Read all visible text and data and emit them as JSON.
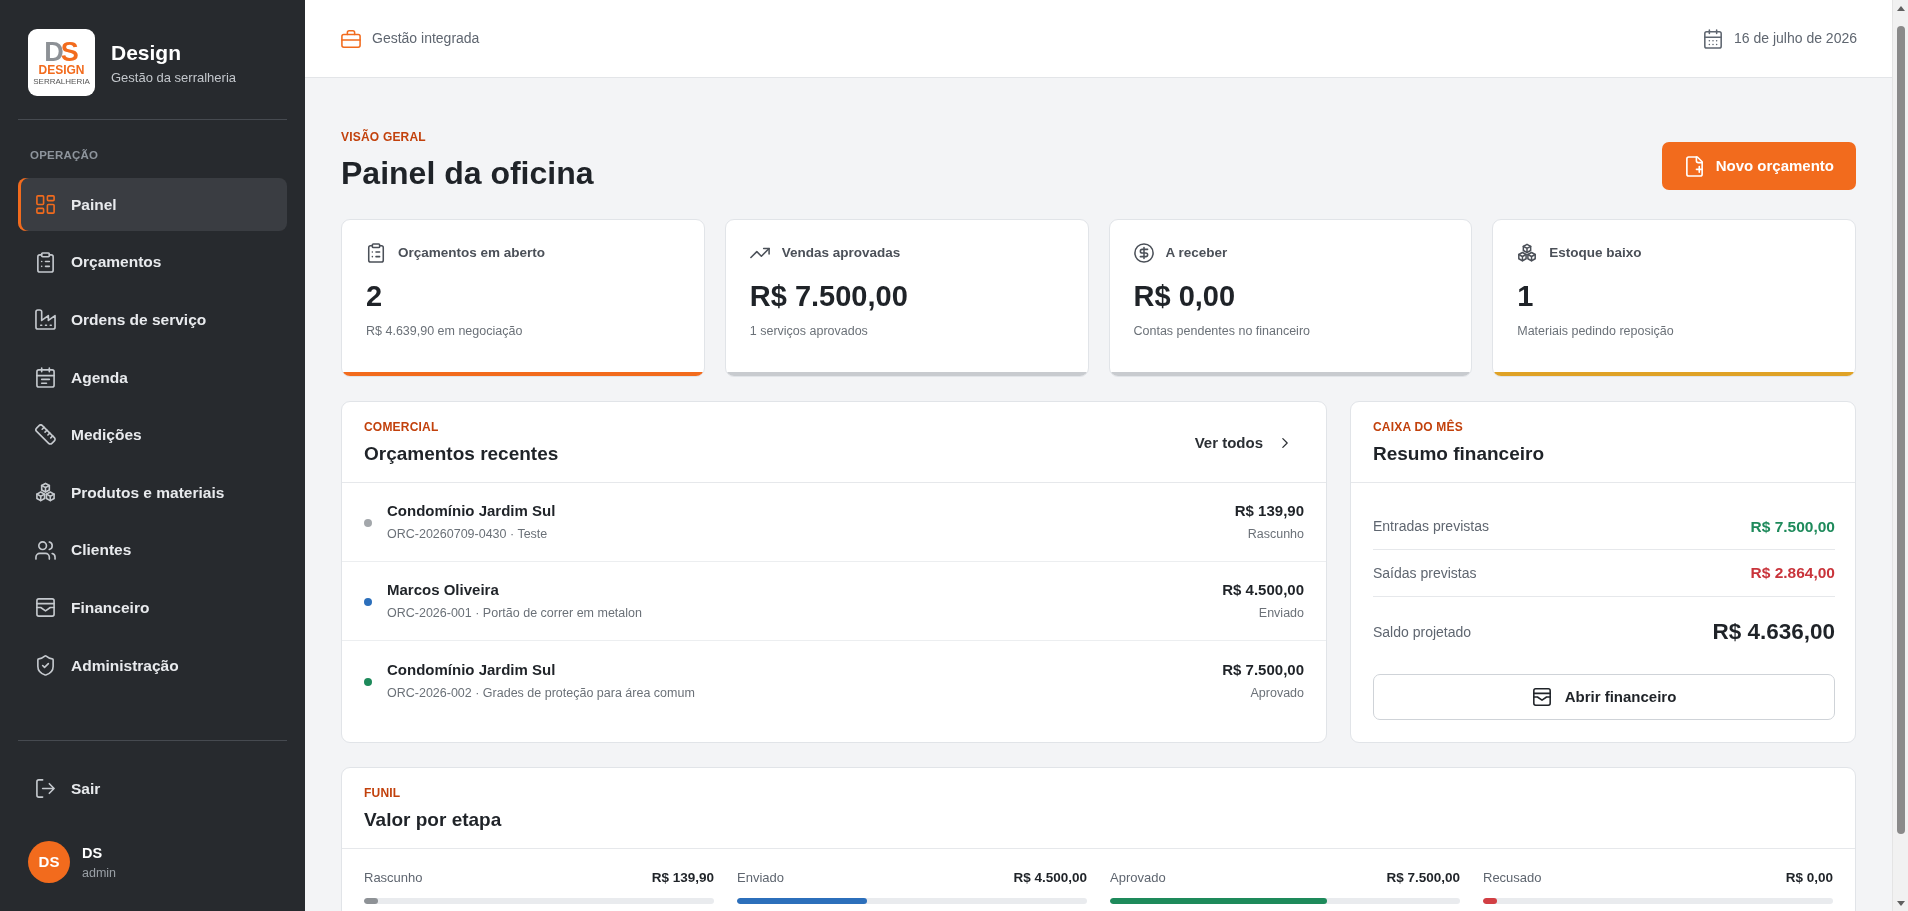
{
  "sidebar": {
    "logo": {
      "monogram": "DS",
      "wordmark": "DESIGN",
      "tagline": "SERRALHERIA"
    },
    "brand": "Design",
    "subtitle": "Gestão da serralheria",
    "section": "OPERAÇÃO",
    "items": [
      {
        "label": "Painel",
        "selected": true
      },
      {
        "label": "Orçamentos",
        "selected": false
      },
      {
        "label": "Ordens de serviço",
        "selected": false
      },
      {
        "label": "Agenda",
        "selected": false
      },
      {
        "label": "Medições",
        "selected": false
      },
      {
        "label": "Produtos e materiais",
        "selected": false
      },
      {
        "label": "Clientes",
        "selected": false
      },
      {
        "label": "Financeiro",
        "selected": false
      },
      {
        "label": "Administração",
        "selected": false
      }
    ],
    "logout": "Sair",
    "user": {
      "initials": "DS",
      "name": "DS",
      "role": "admin"
    }
  },
  "header": {
    "context": "Gestão integrada",
    "date": "16 de julho de 2026"
  },
  "page": {
    "eyebrow": "VISÃO GERAL",
    "title": "Painel da oficina",
    "action": "Novo orçamento"
  },
  "stats": [
    {
      "label": "Orçamentos em aberto",
      "value": "2",
      "note": "R$ 4.639,90 em negociação",
      "color": "#f26b1d"
    },
    {
      "label": "Vendas aprovadas",
      "value": "R$ 7.500,00",
      "note": "1 serviços aprovados",
      "color": "#c8cbcf"
    },
    {
      "label": "A receber",
      "value": "R$ 0,00",
      "note": "Contas pendentes no financeiro",
      "color": "#c8cbcf"
    },
    {
      "label": "Estoque baixo",
      "value": "1",
      "note": "Materiais pedindo reposição",
      "color": "#dfa226"
    }
  ],
  "recent_quotes": {
    "eyebrow": "COMERCIAL",
    "title": "Orçamentos recentes",
    "link": "Ver todos",
    "rows": [
      {
        "client": "Condomínio Jardim Sul",
        "reference": "ORC-20260709-0430 · Teste",
        "amount": "R$ 139,90",
        "status": "Rascunho",
        "color": "#a3a7ab"
      },
      {
        "client": "Marcos Oliveira",
        "reference": "ORC-2026-001 · Portão de correr em metalon",
        "amount": "R$ 4.500,00",
        "status": "Enviado",
        "color": "#2c6fbb"
      },
      {
        "client": "Condomínio Jardim Sul",
        "reference": "ORC-2026-002 · Grades de proteção para área comum",
        "amount": "R$ 7.500,00",
        "status": "Aprovado",
        "color": "#1e8a5b"
      }
    ]
  },
  "finance": {
    "eyebrow": "CAIXA DO MÊS",
    "title": "Resumo financeiro",
    "rows": [
      {
        "kind": "income",
        "label": "Entradas previstas",
        "value": "R$ 7.500,00"
      },
      {
        "kind": "expense",
        "label": "Saídas previstas",
        "value": "R$ 2.864,00"
      },
      {
        "kind": "balance",
        "label": "Saldo projetado",
        "value": "R$ 4.636,00"
      }
    ],
    "button": "Abrir financeiro"
  },
  "funnel": {
    "eyebrow": "FUNIL",
    "title": "Valor por etapa",
    "stages": [
      {
        "label": "Rascunho",
        "amount": "R$ 139,90",
        "level": 0.04,
        "color": "#8e9296"
      },
      {
        "label": "Enviado",
        "amount": "R$ 4.500,00",
        "level": 0.37,
        "color": "#2c6fbb"
      },
      {
        "label": "Aprovado",
        "amount": "R$ 7.500,00",
        "level": 0.62,
        "color": "#1e8a5b"
      },
      {
        "label": "Recusado",
        "amount": "R$ 0,00",
        "level": 0.04,
        "color": "#d23f44"
      }
    ]
  }
}
